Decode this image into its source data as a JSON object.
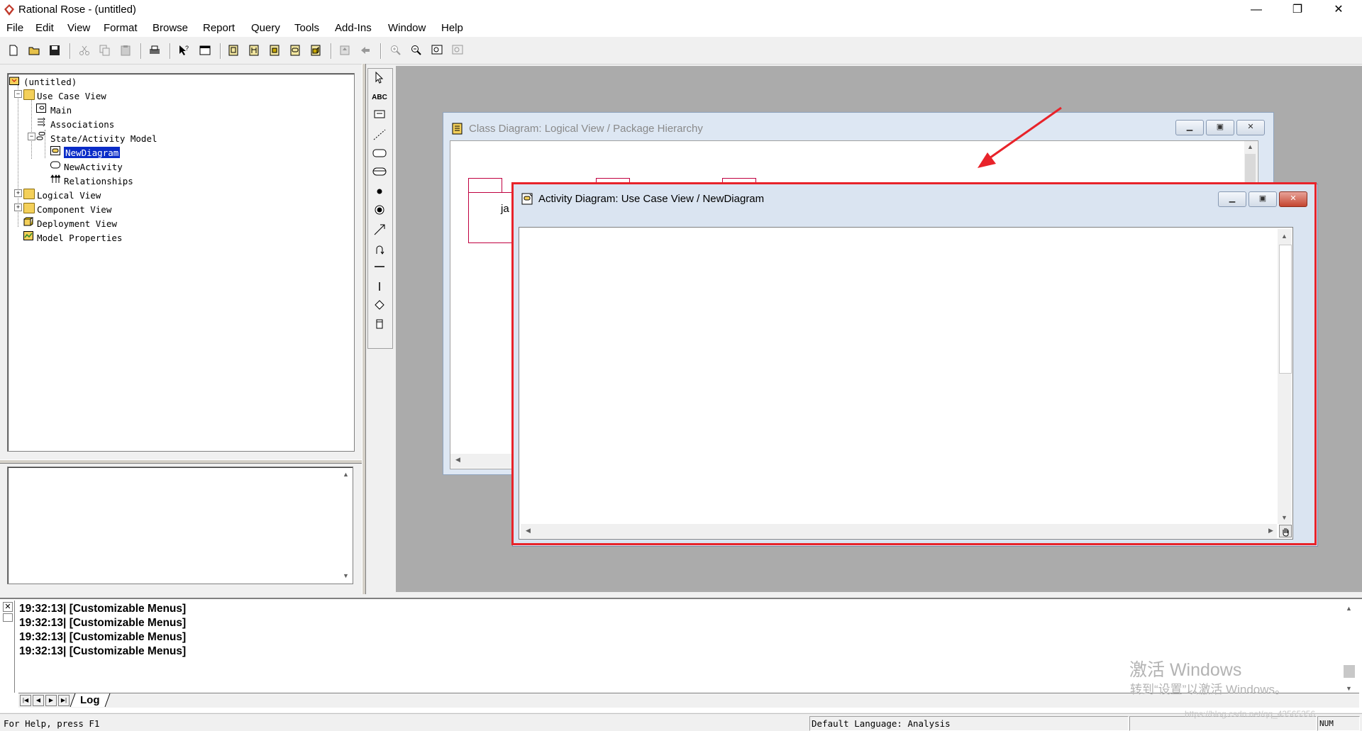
{
  "window": {
    "title": "Rational Rose - (untitled)",
    "minimize": "—",
    "restore": "❐",
    "close": "✕"
  },
  "menu": [
    "File",
    "Edit",
    "View",
    "Format",
    "Browse",
    "Report",
    "Query",
    "Tools",
    "Add-Ins",
    "Window",
    "Help"
  ],
  "browser": {
    "root": "(untitled)",
    "items": [
      {
        "label": "Use Case View"
      },
      {
        "label": "Main"
      },
      {
        "label": "Associations"
      },
      {
        "label": "State/Activity Model"
      },
      {
        "label": "NewDiagram",
        "selected": true
      },
      {
        "label": "NewActivity"
      },
      {
        "label": "Relationships"
      },
      {
        "label": "Logical View"
      },
      {
        "label": "Component View"
      },
      {
        "label": "Deployment View"
      },
      {
        "label": "Model Properties"
      }
    ]
  },
  "toolbox": {
    "text_tool": "ABC"
  },
  "class_window": {
    "title": "Class Diagram: Logical View / Package Hierarchy",
    "package_fragment": "ja"
  },
  "activity_window": {
    "title": "Activity Diagram: Use Case View / NewDiagram"
  },
  "annotation": {
    "color": "#e8232a"
  },
  "log": {
    "lines": [
      "19:32:13|  [Customizable Menus]",
      "19:32:13|  [Customizable Menus]",
      "19:32:13|  [Customizable Menus]",
      "19:32:13|  [Customizable Menus]"
    ],
    "tab": "Log"
  },
  "status": {
    "help": "For Help, press F1",
    "language": "Default Language: Analysis",
    "num": "NUM"
  },
  "watermark": {
    "line1": "激活 Windows",
    "line2": "转到“设置”以激活 Windows。",
    "url": "https://blog.csdn.net/qq_43565356"
  }
}
